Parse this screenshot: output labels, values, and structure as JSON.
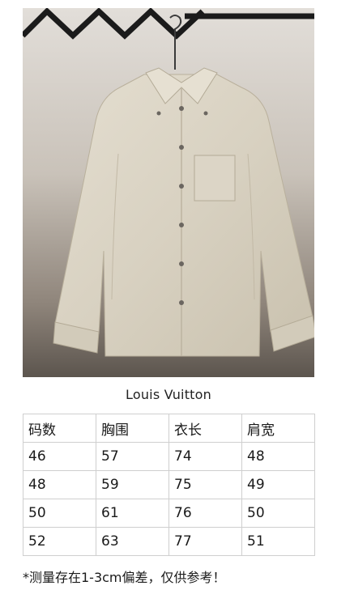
{
  "product": {
    "brand": "Louis Vuitton",
    "image_colors": {
      "shirt": "#d9d3c4",
      "hanger_rail": "#1b1b1b",
      "buttons": "#6b6660"
    }
  },
  "size_table": {
    "headers": [
      "码数",
      "胸围",
      "衣长",
      "肩宽"
    ],
    "rows": [
      [
        "46",
        "57",
        "74",
        "48"
      ],
      [
        "48",
        "59",
        "75",
        "49"
      ],
      [
        "50",
        "61",
        "76",
        "50"
      ],
      [
        "52",
        "63",
        "77",
        "51"
      ]
    ]
  },
  "note": "*测量存在1-3cm偏差，仅供参考！"
}
